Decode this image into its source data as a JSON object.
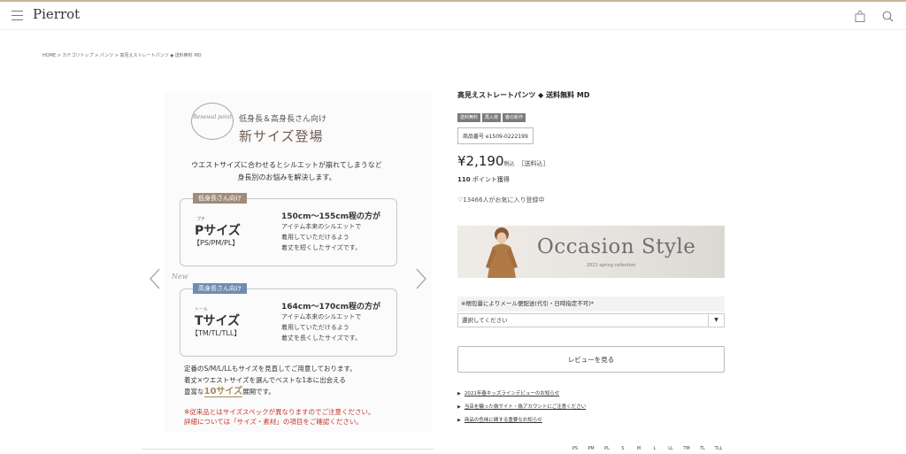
{
  "header": {
    "logo": "Pierrot",
    "menu_icon": "hamburger-menu-icon",
    "bag_icon": "shopping-bag-icon",
    "search_icon": "search-icon"
  },
  "breadcrumb": "HOME > カテゴリトップ > パンツ > 高見えストレートパンツ ◆ 送料無料 MD",
  "gallery": {
    "badge": "Renewal point",
    "subtitle": "低身長＆高身長さん向け",
    "title": "新サイズ登場",
    "intro_line1": "ウエストサイズに合わせるとシルエットが崩れてしまうなど",
    "intro_line2": "身長別のお悩みを解決します。",
    "new_mark": "New",
    "petite": {
      "tag": "低身長さん向け",
      "kana": "プチ",
      "size": "Pサイズ",
      "codes": "【PS/PM/PL】",
      "range": "150cm〜155cm程の方が",
      "desc1": "アイテム本来のシルエットで",
      "desc2": "着用していただけるよう",
      "desc3": "着丈を短くしたサイズです。"
    },
    "tall": {
      "tag": "高身長さん向け",
      "kana": "トール",
      "size": "Tサイズ",
      "codes": "【TM/TL/TLL】",
      "range": "164cm〜170cm程の方が",
      "desc1": "アイテム本来のシルエットで",
      "desc2": "着用していただけるよう",
      "desc3": "着丈を長くしたサイズです。"
    },
    "foot1": "定番のS/M/L/LLもサイズを見直してご用意しております。",
    "foot2": "着丈×ウエストサイズを選んでベストな1本に出会える",
    "foot3_pre": "豊富な",
    "foot3_hl": "10サイズ",
    "foot3_post": "展開です。",
    "note1": "※従来品とはサイズスペックが異なりますのでご注意ください。",
    "note2": "詳細については「サイズ・素材」の項目をご確認ください。"
  },
  "product": {
    "title": "高見えストレートパンツ ◆ 送料無料 MD",
    "tags": [
      "送料無料",
      "再入荷",
      "春の新作"
    ],
    "code": "商品番号 e1509-0222199",
    "price": "¥2,190",
    "tax": "税込",
    "shipping": "［送料込］",
    "points_value": "110",
    "points_label": " ポイント獲得",
    "favorite": "♡13466人がお気に入り登録中"
  },
  "banner": {
    "title": "Occasion Style",
    "subtitle": "2021 spring collection"
  },
  "shipping_option": {
    "label": "※梱包量によりメール便配送(代引・日時指定不可)*",
    "selected": "選択してください"
  },
  "review_button": "レビューを見る",
  "links": [
    "2021年春キッズラインデビューのお知らせ",
    "当店を騙った偽サイト・偽アカウントにご注意ください",
    "商品の色味に関する重要なお知らせ"
  ],
  "size_nav": [
    "PS",
    "PM",
    "PL",
    "S",
    "M",
    "L",
    "LL",
    "TM",
    "TL",
    "TLL"
  ],
  "colors": {
    "accent_line": "#c9b49a",
    "petite_tag": "#a08c7c",
    "tall_tag": "#6f8bb0",
    "note_red": "#c0392b"
  }
}
